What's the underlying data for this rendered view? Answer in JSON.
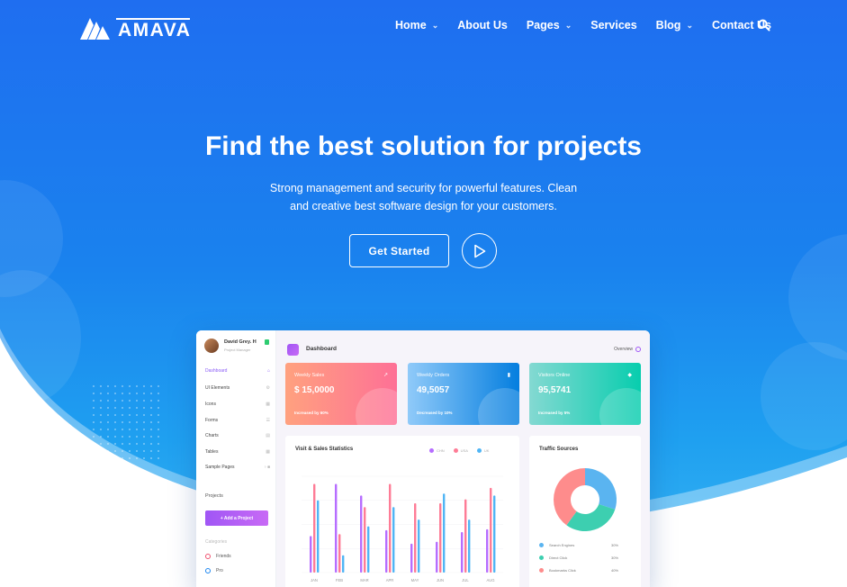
{
  "brand": {
    "name": "AMAVA"
  },
  "nav": {
    "items": [
      {
        "label": "Home",
        "has_dropdown": true
      },
      {
        "label": "About Us",
        "has_dropdown": false
      },
      {
        "label": "Pages",
        "has_dropdown": true
      },
      {
        "label": "Services",
        "has_dropdown": false
      },
      {
        "label": "Blog",
        "has_dropdown": true
      },
      {
        "label": "Contact Us",
        "has_dropdown": false
      }
    ],
    "search_icon": "search-icon"
  },
  "hero": {
    "headline": "Find the best solution for projects",
    "subtext": "Strong management and security for powerful features. Clean and creative best software design for your customers.",
    "cta_label": "Get Started",
    "play_icon": "play-icon"
  },
  "dashboard": {
    "user": {
      "name": "David Grey. H",
      "role": "Project Manager"
    },
    "sidebar": [
      {
        "label": "Dashboard",
        "icon": "home-icon",
        "active": true
      },
      {
        "label": "UI Elements",
        "icon": "gear-icon",
        "active": false
      },
      {
        "label": "Icons",
        "icon": "grid-icon",
        "active": false
      },
      {
        "label": "Forms",
        "icon": "list-icon",
        "active": false
      },
      {
        "label": "Charts",
        "icon": "chart-icon",
        "active": false
      },
      {
        "label": "Tables",
        "icon": "table-icon",
        "active": false
      },
      {
        "label": "Sample Pages",
        "icon": "lock-icon",
        "active": false
      }
    ],
    "projects_heading": "Projects",
    "add_project_label": "+ Add a Project",
    "categories_heading": "Categories",
    "categories": [
      {
        "label": "Friends",
        "color": "#f0506e"
      },
      {
        "label": "Pro",
        "color": "#1e87f0"
      }
    ],
    "title": "Dashboard",
    "overview_label": "Overview",
    "cards": [
      {
        "title": "Weekly Sales",
        "value": "$ 15,0000",
        "footer": "Increased by 60%",
        "icon": "chart-icon",
        "gradient": [
          "#ffa17f",
          "#fe7096"
        ]
      },
      {
        "title": "Weekly Orders",
        "value": "49,5057",
        "footer": "Decreased by 10%",
        "icon": "bookmark-icon",
        "gradient": [
          "#90caf9",
          "#047edf"
        ]
      },
      {
        "title": "Visitors Online",
        "value": "95,5741",
        "footer": "Increased by 5%",
        "icon": "diamond-icon",
        "gradient": [
          "#84d9d2",
          "#07cdae"
        ]
      }
    ],
    "stats_title": "Visit & Sales Statistics",
    "stats_legend": [
      {
        "name": "CHN",
        "color": "#b66dff"
      },
      {
        "name": "USA",
        "color": "#fe7c96"
      },
      {
        "name": "UK",
        "color": "#50b5f5"
      }
    ],
    "traffic_title": "Traffic Sources",
    "traffic_rows": [
      {
        "label": "Search Engines",
        "value": "30%",
        "color": "#5ab4f0"
      },
      {
        "label": "Direct Click",
        "value": "30%",
        "color": "#3dcfb0"
      },
      {
        "label": "Bookmarks Click",
        "value": "40%",
        "color": "#fe8c8c"
      }
    ]
  },
  "chart_data": [
    {
      "type": "bar",
      "title": "Visit & Sales Statistics",
      "categories": [
        "JAN",
        "FEB",
        "MAR",
        "APR",
        "MAY",
        "JUN",
        "JUL",
        "AUG"
      ],
      "series": [
        {
          "name": "CHN",
          "values": [
            38,
            92,
            80,
            44,
            30,
            32,
            42,
            45
          ]
        },
        {
          "name": "USA",
          "values": [
            92,
            40,
            68,
            92,
            72,
            72,
            76,
            88
          ]
        },
        {
          "name": "UK",
          "values": [
            75,
            18,
            48,
            68,
            55,
            82,
            55,
            80
          ]
        }
      ],
      "ylim": [
        0,
        100
      ]
    },
    {
      "type": "pie",
      "title": "Traffic Sources",
      "labels": [
        "Search Engines",
        "Direct Click",
        "Bookmarks Click"
      ],
      "values": [
        30,
        30,
        40
      ]
    }
  ]
}
